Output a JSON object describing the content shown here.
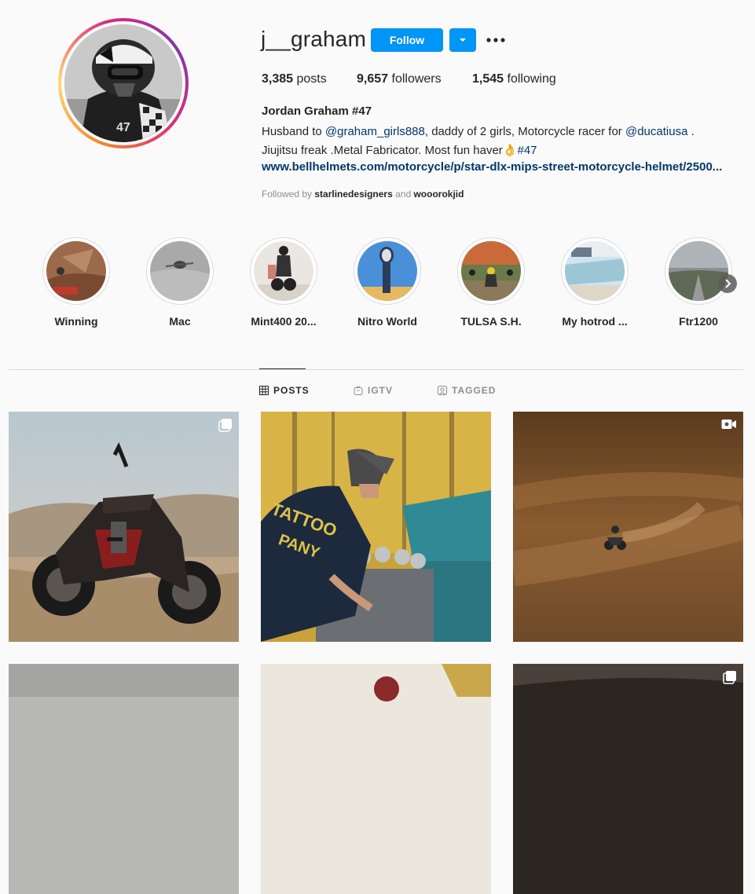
{
  "profile": {
    "username": "j__graham",
    "follow_label": "Follow",
    "stats": {
      "posts_count": "3,385",
      "posts_label": "posts",
      "followers_count": "9,657",
      "followers_label": "followers",
      "following_count": "1,545",
      "following_label": "following"
    },
    "full_name": "Jordan Graham #47",
    "bio": {
      "line1_pre": "Husband to ",
      "mention1": "@graham_girls888",
      "line1_mid": ", daddy of 2 girls, Motorcycle racer for ",
      "mention2": "@ducatiusa",
      "line1_post": " .",
      "line2_pre": "Jiujitsu freak .Metal Fabricator. Most fun haver",
      "emoji": "👌",
      "hashtag": "#47"
    },
    "website": "www.bellhelmets.com/motorcycle/p/star-dlx-mips-street-motorcycle-helmet/2500...",
    "followed_by": {
      "prefix": "Followed by",
      "user1": "starlinedesigners",
      "and": "and",
      "user2": "wooorokjid"
    }
  },
  "highlights": [
    {
      "label": "Winning"
    },
    {
      "label": "Mac"
    },
    {
      "label": "Mint400 20..."
    },
    {
      "label": "Nitro World"
    },
    {
      "label": "TULSA S.H."
    },
    {
      "label": "My hotrod ..."
    },
    {
      "label": "Ftr1200"
    }
  ],
  "tabs": [
    {
      "label": "POSTS",
      "icon": "grid-icon",
      "active": true
    },
    {
      "label": "IGTV",
      "icon": "igtv-icon",
      "active": false
    },
    {
      "label": "TAGGED",
      "icon": "tagged-icon",
      "active": false
    }
  ],
  "posts": [
    {
      "type": "carousel",
      "icon": "carousel-icon",
      "subject": "motorcycle in desert"
    },
    {
      "type": "image",
      "subject": "man working on engine"
    },
    {
      "type": "video",
      "icon": "video-icon",
      "subject": "rider on dirt track"
    },
    {
      "type": "image"
    },
    {
      "type": "image"
    },
    {
      "type": "carousel",
      "icon": "carousel-icon"
    }
  ],
  "colors": {
    "accent": "#0095f6",
    "link": "#00376b",
    "text": "#262626",
    "muted": "#8e8e8e",
    "background": "#fafafa"
  }
}
